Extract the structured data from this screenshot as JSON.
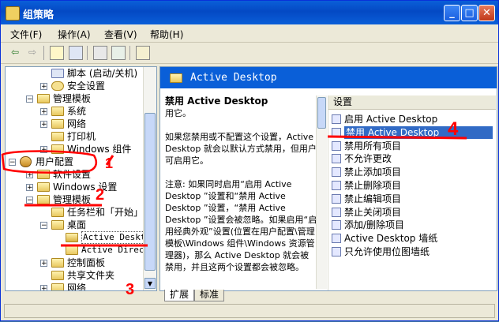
{
  "window": {
    "title": "组策略",
    "min_label": "_",
    "max_label": "□",
    "close_label": "✕"
  },
  "menu": [
    "文件(F)",
    "操作(A)",
    "查看(V)",
    "帮助(H)"
  ],
  "toolbar": {
    "back_glyph": "⇦",
    "forward_glyph": "⇨"
  },
  "tree": {
    "items": [
      {
        "label": "脚本 (启动/关机)"
      },
      {
        "label": "安全设置"
      },
      {
        "label": "管理模板"
      },
      {
        "label": "系统"
      },
      {
        "label": "网络"
      },
      {
        "label": "打印机"
      },
      {
        "label": "Windows 组件"
      },
      {
        "label": "用户配置"
      },
      {
        "label": "软件设置"
      },
      {
        "label": "Windows 设置"
      },
      {
        "label": "管理模板"
      },
      {
        "label": "任务栏和「开始」"
      },
      {
        "label": "桌面"
      },
      {
        "label": "Active Deskto"
      },
      {
        "label": "Active Direct"
      },
      {
        "label": "控制面板"
      },
      {
        "label": "共享文件夹"
      },
      {
        "label": "网络"
      }
    ]
  },
  "right": {
    "header": "Active Desktop",
    "desc_title": "禁用 Active Desktop",
    "desc_body": "用它。\n\n如果您禁用或不配置这个设置，Active Desktop 就会以默认方式禁用，但用户可启用它。\n\n注意: 如果同时启用“启用 Active Desktop ”设置和“禁用 Active Desktop ”设置，“禁用 Active Desktop ”设置会被忽略。如果启用“启用经典外观”设置(位置在用户配置\\管理模板\\Windows 组件\\Windows 资源管理器)，那么 Active Desktop 就会被禁用，并且这两个设置都会被忽略。",
    "list_header": "设置",
    "list": [
      "启用 Active Desktop",
      "禁用 Active Desktop",
      "禁用所有项目",
      "不允许更改",
      "禁止添加项目",
      "禁止删除项目",
      "禁止编辑项目",
      "禁止关闭项目",
      "添加/删除项目",
      "Active Desktop 墙纸",
      "只允许使用位图墙纸"
    ],
    "selected_index": 1
  },
  "tabs": [
    "扩展",
    "标准"
  ],
  "annotations": [
    "1",
    "2",
    "3",
    "4"
  ],
  "colors": {
    "title_bar": "#0a5fd8",
    "selection": "#316ac5",
    "annotation": "#ff0000",
    "window_bg": "#ece9d8"
  }
}
